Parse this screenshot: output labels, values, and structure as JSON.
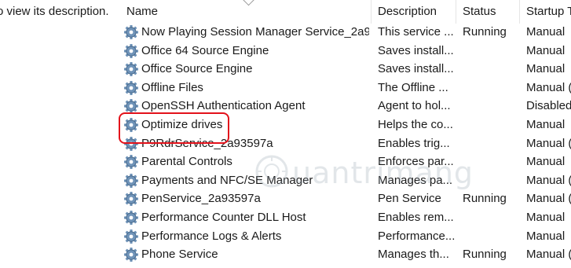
{
  "left_hint": "o view its description.",
  "columns": {
    "name": "Name",
    "description": "Description",
    "status": "Status",
    "startup": "Startup T"
  },
  "services": [
    {
      "name": "Now Playing Session Manager Service_2a9...",
      "description": "This service ...",
      "status": "Running",
      "startup": "Manual"
    },
    {
      "name": "Office 64 Source Engine",
      "description": "Saves install...",
      "status": "",
      "startup": "Manual"
    },
    {
      "name": "Office Source Engine",
      "description": "Saves install...",
      "status": "",
      "startup": "Manual"
    },
    {
      "name": "Offline Files",
      "description": "The Offline ...",
      "status": "",
      "startup": "Manual ("
    },
    {
      "name": "OpenSSH Authentication Agent",
      "description": "Agent to hol...",
      "status": "",
      "startup": "Disabled"
    },
    {
      "name": "Optimize drives",
      "description": "Helps the co...",
      "status": "",
      "startup": "Manual"
    },
    {
      "name": "P9RdrService_2a93597a",
      "description": "Enables trig...",
      "status": "",
      "startup": "Manual ("
    },
    {
      "name": "Parental Controls",
      "description": "Enforces par...",
      "status": "",
      "startup": "Manual"
    },
    {
      "name": "Payments and NFC/SE Manager",
      "description": "Manages pa...",
      "status": "",
      "startup": "Manual ("
    },
    {
      "name": "PenService_2a93597a",
      "description": "Pen Service",
      "status": "Running",
      "startup": "Manual ("
    },
    {
      "name": "Performance Counter DLL Host",
      "description": "Enables rem...",
      "status": "",
      "startup": "Manual"
    },
    {
      "name": "Performance Logs & Alerts",
      "description": "Performance...",
      "status": "",
      "startup": "Manual"
    },
    {
      "name": "Phone Service",
      "description": "Manages th...",
      "status": "Running",
      "startup": "Manual ("
    }
  ],
  "highlighted_service": "Optimize drives",
  "watermark": "uantrimang",
  "icons": {
    "service": "gear-icon",
    "watermark_logo": "quantrimang-logo-icon"
  },
  "colors": {
    "highlight": "#e3121b",
    "gear_fill": "#6f93b8"
  }
}
